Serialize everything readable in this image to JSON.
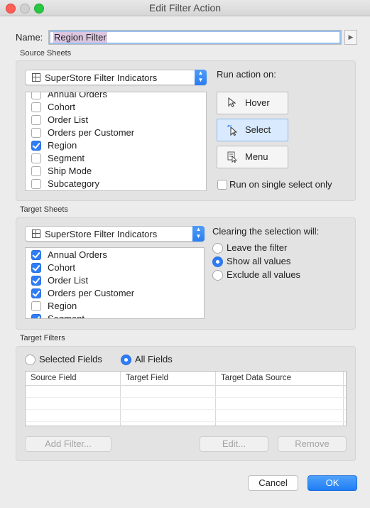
{
  "window": {
    "title": "Edit Filter Action"
  },
  "name": {
    "label": "Name:",
    "value": "Region Filter"
  },
  "source_sheets": {
    "label": "Source Sheets",
    "dropdown": "SuperStore Filter Indicators",
    "items": [
      {
        "label": "Annual Orders",
        "checked": false
      },
      {
        "label": "Cohort",
        "checked": false
      },
      {
        "label": "Order List",
        "checked": false
      },
      {
        "label": "Orders per Customer",
        "checked": false
      },
      {
        "label": "Region",
        "checked": true
      },
      {
        "label": "Segment",
        "checked": false
      },
      {
        "label": "Ship Mode",
        "checked": false
      },
      {
        "label": "Subcategory",
        "checked": false
      }
    ]
  },
  "run_action": {
    "label": "Run action on:",
    "buttons": [
      {
        "label": "Hover",
        "icon": "cursor-icon",
        "active": false
      },
      {
        "label": "Select",
        "icon": "select-cursor-icon",
        "active": true
      },
      {
        "label": "Menu",
        "icon": "menu-icon",
        "active": false
      }
    ],
    "single_select_label": "Run on single select only",
    "single_select_checked": false
  },
  "target_sheets": {
    "label": "Target Sheets",
    "dropdown": "SuperStore Filter Indicators",
    "items": [
      {
        "label": "Annual Orders",
        "checked": true
      },
      {
        "label": "Cohort",
        "checked": true
      },
      {
        "label": "Order List",
        "checked": true
      },
      {
        "label": "Orders per Customer",
        "checked": true
      },
      {
        "label": "Region",
        "checked": false
      },
      {
        "label": "Segment",
        "checked": true
      }
    ]
  },
  "clearing": {
    "label": "Clearing the selection will:",
    "options": [
      {
        "label": "Leave the filter",
        "selected": false
      },
      {
        "label": "Show all values",
        "selected": true
      },
      {
        "label": "Exclude all values",
        "selected": false
      }
    ]
  },
  "target_filters": {
    "label": "Target Filters",
    "mode_options": [
      {
        "label": "Selected Fields",
        "selected": false
      },
      {
        "label": "All Fields",
        "selected": true
      }
    ],
    "columns": [
      "Source Field",
      "Target Field",
      "Target Data Source"
    ],
    "buttons": {
      "add": "Add Filter...",
      "edit": "Edit...",
      "remove": "Remove"
    }
  },
  "footer": {
    "cancel": "Cancel",
    "ok": "OK"
  },
  "colors": {
    "accent": "#2f7cf6",
    "selected_button": "#d9eafe"
  }
}
